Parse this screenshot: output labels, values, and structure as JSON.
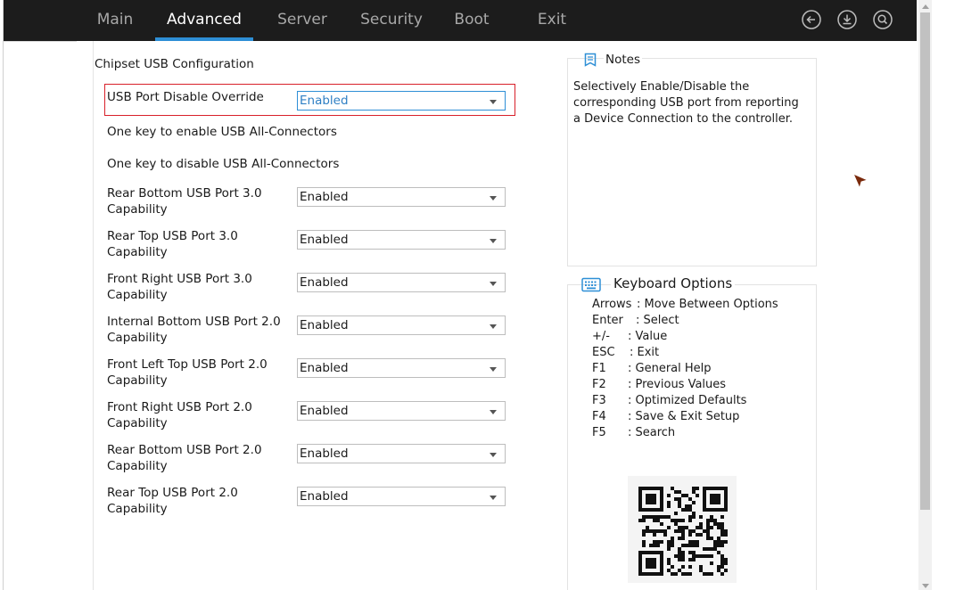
{
  "tabs": [
    {
      "label": "Main",
      "active": false
    },
    {
      "label": "Advanced",
      "active": true
    },
    {
      "label": "Server",
      "active": false
    },
    {
      "label": "Security",
      "active": false
    },
    {
      "label": "Boot",
      "active": false
    },
    {
      "label": "Exit",
      "active": false
    }
  ],
  "toolbar_icons": [
    "back-icon",
    "download-icon",
    "search-icon"
  ],
  "section_title": "Chipset USB Configuration",
  "override": {
    "label": "USB Port Disable Override",
    "value": "Enabled"
  },
  "actions": {
    "enable_all": "One key to enable USB All-Connectors",
    "disable_all": "One key to disable USB All-Connectors"
  },
  "ports": [
    {
      "label": "Rear Bottom USB Port 3.0 Capability",
      "value": "Enabled"
    },
    {
      "label": "Rear Top USB Port 3.0 Capability",
      "value": "Enabled"
    },
    {
      "label": "Front Right USB Port 3.0 Capability",
      "value": "Enabled"
    },
    {
      "label": "Internal Bottom USB Port 2.0 Capability",
      "value": "Enabled"
    },
    {
      "label": "Front Left Top USB Port 2.0 Capability",
      "value": "Enabled"
    },
    {
      "label": "Front Right USB Port 2.0 Capability",
      "value": "Enabled"
    },
    {
      "label": "Rear Bottom USB Port 2.0 Capability",
      "value": "Enabled"
    },
    {
      "label": "Rear Top USB Port 2.0 Capability",
      "value": "Enabled"
    }
  ],
  "notes": {
    "title": "Notes",
    "text": "Selectively Enable/Disable the corresponding USB port from reporting a Device Connection to the controller."
  },
  "keyboard": {
    "title": "Keyboard Options",
    "items": [
      {
        "key": "Arrows",
        "desc": ": Move Between Options"
      },
      {
        "key": "Enter",
        "desc": ": Select"
      },
      {
        "key": "+/-",
        "desc": ": Value"
      },
      {
        "key": "ESC",
        "desc": ": Exit"
      },
      {
        "key": "F1",
        "desc": ": General Help"
      },
      {
        "key": "F2",
        "desc": ": Previous Values"
      },
      {
        "key": "F3",
        "desc": ": Optimized Defaults"
      },
      {
        "key": "F4",
        "desc": ": Save & Exit Setup"
      },
      {
        "key": "F5",
        "desc": ": Search"
      }
    ]
  },
  "colors": {
    "accent": "#2e8fd6",
    "focus_border": "#d8202a",
    "topbar": "#1c1c1c"
  }
}
